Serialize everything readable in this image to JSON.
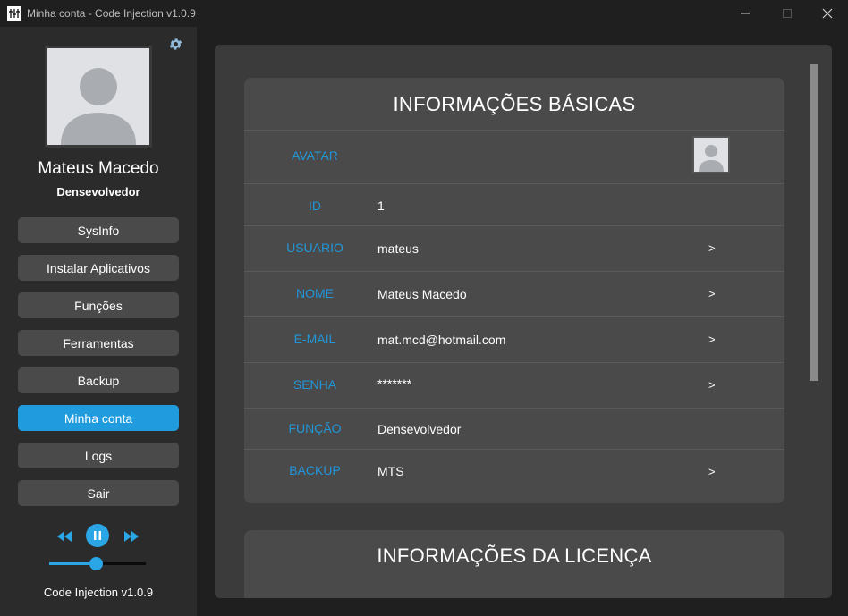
{
  "window": {
    "title": "Minha conta - Code Injection v1.0.9"
  },
  "sidebar": {
    "user_name": "Mateus Macedo",
    "user_role": "Densevolvedor",
    "menu": [
      {
        "label": "SysInfo",
        "active": false
      },
      {
        "label": "Instalar Aplicativos",
        "active": false
      },
      {
        "label": "Funções",
        "active": false
      },
      {
        "label": "Ferramentas",
        "active": false
      },
      {
        "label": "Backup",
        "active": false
      },
      {
        "label": "Minha conta",
        "active": true
      },
      {
        "label": "Logs",
        "active": false
      },
      {
        "label": "Sair",
        "active": false
      }
    ],
    "player": {
      "volume_percent": 48
    },
    "version": "Code Injection v1.0.9"
  },
  "basic_info": {
    "title": "INFORMAÇÕES BÁSICAS",
    "rows": [
      {
        "label": "AVATAR",
        "value": "",
        "arrow": ""
      },
      {
        "label": "ID",
        "value": "1",
        "arrow": ""
      },
      {
        "label": "USUARIO",
        "value": "mateus",
        "arrow": ">"
      },
      {
        "label": "NOME",
        "value": "Mateus Macedo",
        "arrow": ">"
      },
      {
        "label": "E-MAIL",
        "value": "mat.mcd@hotmail.com",
        "arrow": ">"
      },
      {
        "label": "SENHA",
        "value": "*******",
        "arrow": ">"
      },
      {
        "label": "FUNÇÃO",
        "value": "Densevolvedor",
        "arrow": ""
      },
      {
        "label": "BACKUP",
        "value": "MTS",
        "arrow": ">"
      }
    ]
  },
  "license_info": {
    "title": "INFORMAÇÕES DA LICENÇA"
  },
  "colors": {
    "accent": "#1f9bde",
    "label_blue": "#2196d8",
    "sidebar_bg": "#2b2b2b",
    "card_bg": "#4a4a4a"
  }
}
